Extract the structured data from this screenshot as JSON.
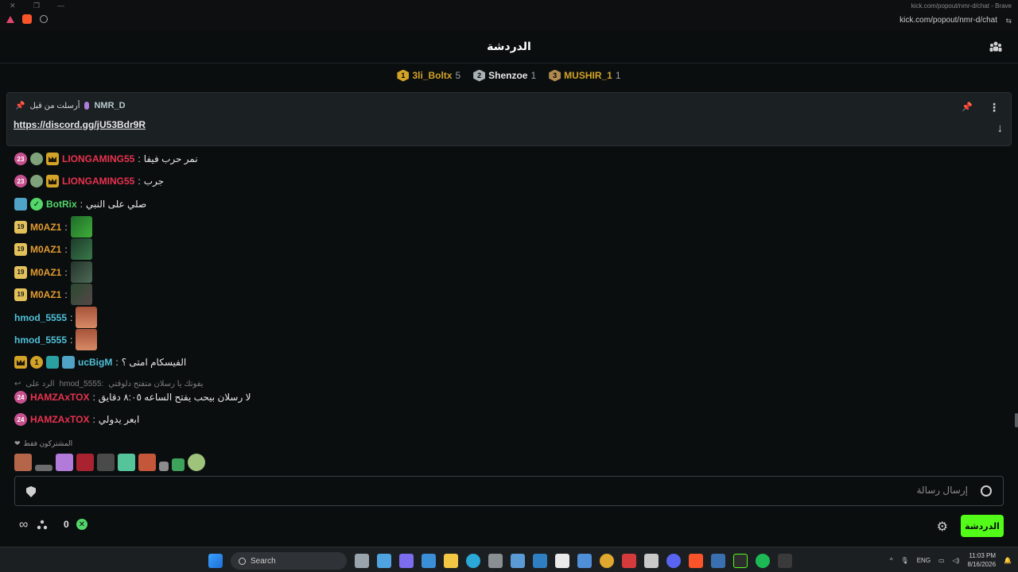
{
  "browser": {
    "window_url_top": "kick.com/popout/nmr-d/chat - Brave",
    "address": "kick.com/popout/nmr-d/chat"
  },
  "header": {
    "title": "الدردشة"
  },
  "leaderboard": [
    {
      "rank": "1",
      "name": "3li_Boltx",
      "count": "5",
      "color": "#d3a328"
    },
    {
      "rank": "2",
      "name": "Shenzoe",
      "count": "1",
      "color": "#a9b1b6"
    },
    {
      "rank": "3",
      "name": "MUSHIR_1",
      "count": "1",
      "color": "#b08a4e"
    }
  ],
  "pinned": {
    "label": "أرسلت من قبل",
    "user": "NMR_D",
    "link": "https://discord.gg/jU53Bdr9R"
  },
  "messages": [
    {
      "user": "LIONGAMING55",
      "badge_num": "23",
      "text": "نمر حرب فيفا",
      "color": "#e8334f"
    },
    {
      "user": "LIONGAMING55",
      "badge_num": "23",
      "text": "جرب",
      "color": "#e8334f"
    },
    {
      "user": "BotRix",
      "text": "صلي على النبي",
      "color": "#53d769"
    },
    {
      "user": "M0AZ1",
      "badge_num": "19",
      "color": "#e39b2f"
    },
    {
      "user": "M0AZ1",
      "badge_num": "19",
      "color": "#e39b2f"
    },
    {
      "user": "M0AZ1",
      "badge_num": "19",
      "color": "#e39b2f"
    },
    {
      "user": "M0AZ1",
      "badge_num": "19",
      "color": "#e39b2f"
    },
    {
      "user": "hmod_5555",
      "color": "#4fc1d9"
    },
    {
      "user": "hmod_5555",
      "color": "#4fc1d9"
    },
    {
      "user": "ucBigM",
      "badge_num": "1",
      "text": "الفيسكام امتى ؟",
      "color": "#4fc1d9"
    },
    {
      "user": "HAMZAxTOX",
      "badge_num": "24",
      "text": "لا رسلان بيحب يفتح الساعه ٨:٠٥ دقايق",
      "color": "#e8334f"
    },
    {
      "user": "HAMZAxTOX",
      "badge_num": "24",
      "text": "ابعر يدولي",
      "color": "#e8334f"
    }
  ],
  "reply": {
    "prefix": "الرد على",
    "target": "hmod_5555:",
    "text": "يفوتك يا رسلان متفتح دلوقتي"
  },
  "subs_only_label": "المشتركون فقط",
  "input": {
    "placeholder": "إرسال رسالة"
  },
  "footer": {
    "points": "0",
    "chat_button": "الدردشة"
  },
  "taskbar": {
    "search_label": "Search",
    "lang": "ENG",
    "time": "11:03 PM",
    "date": "8/16/2026"
  }
}
